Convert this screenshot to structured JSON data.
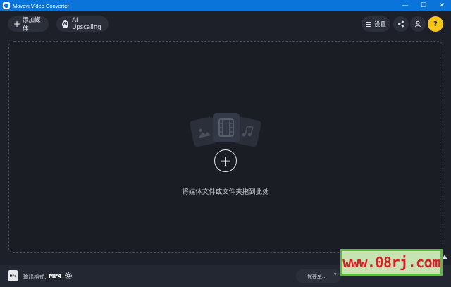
{
  "window": {
    "title": "Movavi Video Converter",
    "controls": {
      "minimize": "—",
      "maximize": "☐",
      "close": "✕"
    }
  },
  "toolbar": {
    "add_media_label": "添加媒体",
    "ai_badge": "AI",
    "ai_upscaling_label": "AI Upscaling",
    "settings_label": "设置",
    "help_label": "?"
  },
  "dropzone": {
    "hint": "将媒体文件或文件夹拖到此处",
    "add_symbol": "+"
  },
  "bottom": {
    "format_icon_text": "MP4",
    "output_format_label": "输出格式:",
    "output_format_value": "MP4",
    "save_to_label": "保存至..."
  },
  "watermark": {
    "text": "www.08rj.com"
  },
  "colors": {
    "titlebar": "#0a74da",
    "background": "#1d2029",
    "help_accent": "#f5c518",
    "watermark_text": "#d31f26",
    "watermark_border": "#5cba3c"
  }
}
